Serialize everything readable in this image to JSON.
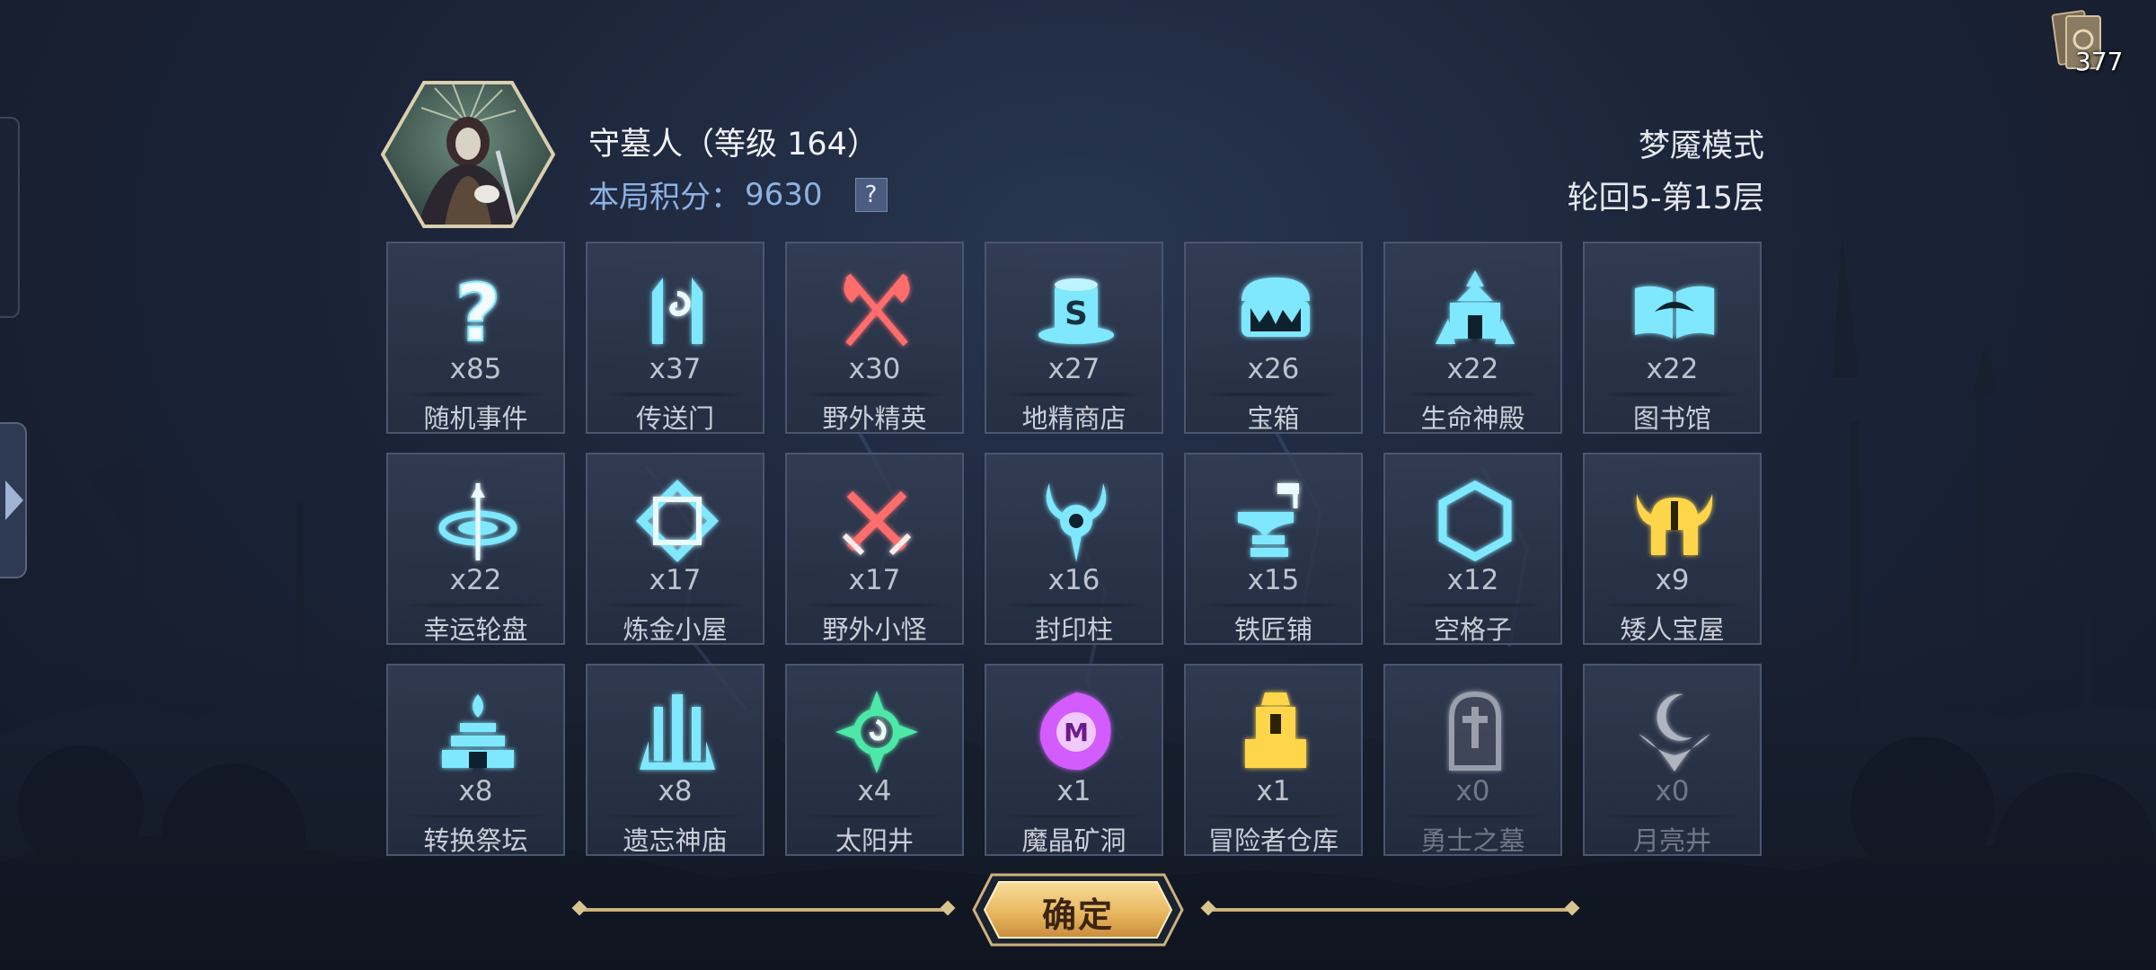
{
  "hud": {
    "card_count": "377"
  },
  "header": {
    "hero_name": "守墓人（等级 164）",
    "score_label": "本局积分：",
    "score_value": "9630",
    "help": "?",
    "mode": "梦魇模式",
    "progress": "轮回5-第15层"
  },
  "tiles": [
    {
      "icon": "question-icon",
      "count": "x85",
      "label": "随机事件",
      "color": "#7fe8ff"
    },
    {
      "icon": "portal-icon",
      "count": "x37",
      "label": "传送门",
      "color": "#7fe8ff"
    },
    {
      "icon": "crossed-axes-icon",
      "count": "x30",
      "label": "野外精英",
      "color": "#ff6d6d"
    },
    {
      "icon": "top-hat-shop-icon",
      "count": "x27",
      "label": "地精商店",
      "color": "#7fe8ff"
    },
    {
      "icon": "treasure-chest-icon",
      "count": "x26",
      "label": "宝箱",
      "color": "#7fe8ff"
    },
    {
      "icon": "temple-icon",
      "count": "x22",
      "label": "生命神殿",
      "color": "#7fe8ff"
    },
    {
      "icon": "open-book-icon",
      "count": "x22",
      "label": "图书馆",
      "color": "#7fe8ff"
    },
    {
      "icon": "wheel-icon",
      "count": "x22",
      "label": "幸运轮盘",
      "color": "#7fe8ff"
    },
    {
      "icon": "alchemy-knot-icon",
      "count": "x17",
      "label": "炼金小屋",
      "color": "#7fe8ff"
    },
    {
      "icon": "crossed-swords-icon",
      "count": "x17",
      "label": "野外小怪",
      "color": "#ff6d6d"
    },
    {
      "icon": "horned-pillar-icon",
      "count": "x16",
      "label": "封印柱",
      "color": "#7fe8ff"
    },
    {
      "icon": "anvil-icon",
      "count": "x15",
      "label": "铁匠铺",
      "color": "#7fe8ff"
    },
    {
      "icon": "hexagon-icon",
      "count": "x12",
      "label": "空格子",
      "color": "#7fe8ff"
    },
    {
      "icon": "viking-helmet-icon",
      "count": "x9",
      "label": "矮人宝屋",
      "color": "#ffd54a"
    },
    {
      "icon": "altar-icon",
      "count": "x8",
      "label": "转换祭坛",
      "color": "#7fe8ff"
    },
    {
      "icon": "shrine-icon",
      "count": "x8",
      "label": "遗忘神庙",
      "color": "#7fe8ff"
    },
    {
      "icon": "sun-well-icon",
      "count": "x4",
      "label": "太阳井",
      "color": "#4de8a8"
    },
    {
      "icon": "crystal-mine-icon",
      "count": "x1",
      "label": "魔晶矿洞",
      "color": "#d35cff"
    },
    {
      "icon": "warehouse-icon",
      "count": "x1",
      "label": "冒险者仓库",
      "color": "#ffd54a"
    },
    {
      "icon": "tombstone-icon",
      "count": "x0",
      "label": "勇士之墓",
      "color": "#c8ccd4",
      "dim": true
    },
    {
      "icon": "moon-well-icon",
      "count": "x0",
      "label": "月亮井",
      "color": "#e8ecf4",
      "dim": true
    }
  ],
  "confirm": {
    "label": "确定"
  }
}
